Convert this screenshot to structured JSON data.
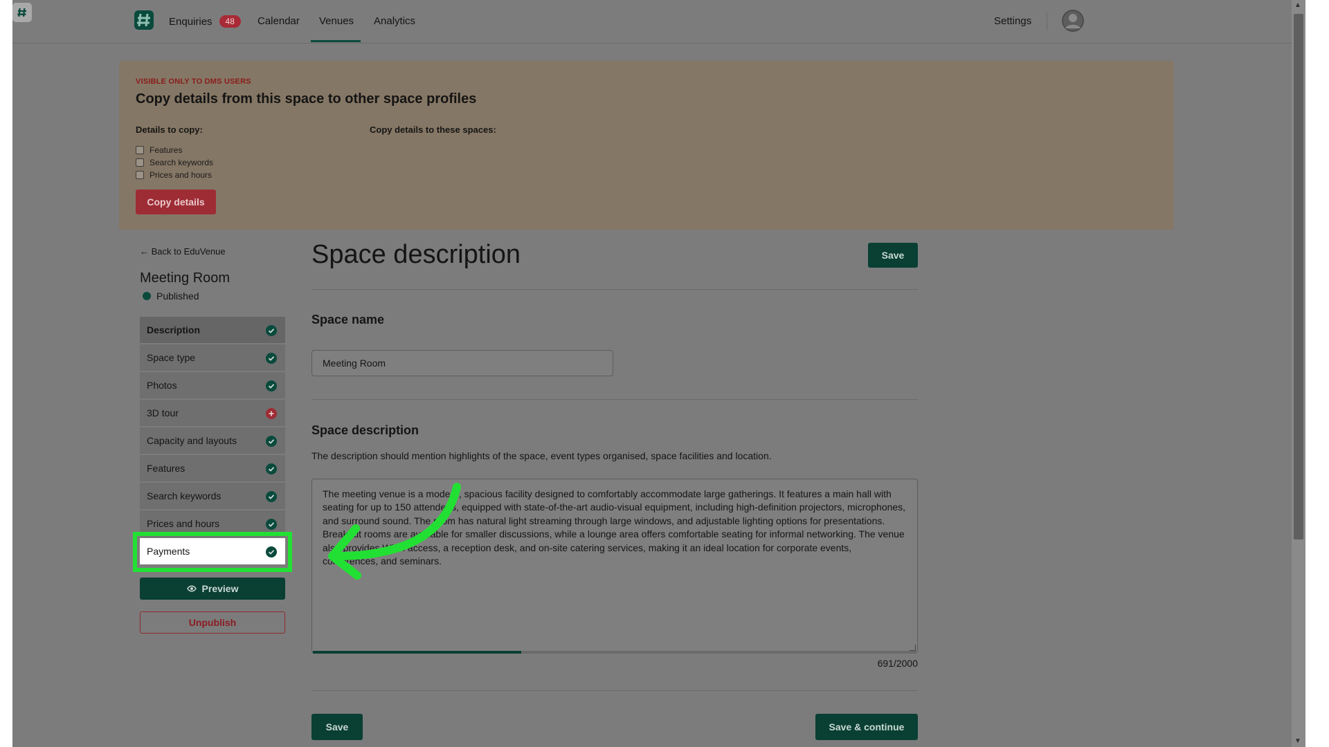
{
  "nav": {
    "items": [
      {
        "label": "Enquiries",
        "badge": "48"
      },
      {
        "label": "Calendar"
      },
      {
        "label": "Venues",
        "active": true
      },
      {
        "label": "Analytics"
      }
    ],
    "settings": "Settings"
  },
  "copy_panel": {
    "kicker": "VISIBLE ONLY TO DMS USERS",
    "title": "Copy details from this space to other space profiles",
    "details_label": "Details to copy:",
    "targets_label": "Copy details to these spaces:",
    "options": [
      "Features",
      "Search keywords",
      "Prices and hours"
    ],
    "button": "Copy details"
  },
  "sidebar": {
    "back_link": "Back to EduVenue",
    "room_title": "Meeting Room",
    "status": "Published",
    "items": [
      {
        "label": "Description",
        "status": "complete"
      },
      {
        "label": "Space type",
        "status": "complete"
      },
      {
        "label": "Photos",
        "status": "complete"
      },
      {
        "label": "3D tour",
        "status": "incomplete"
      },
      {
        "label": "Capacity and layouts",
        "status": "complete"
      },
      {
        "label": "Features",
        "status": "complete"
      },
      {
        "label": "Search keywords",
        "status": "complete"
      },
      {
        "label": "Prices and hours",
        "status": "complete"
      },
      {
        "label": "Payments",
        "status": "complete"
      }
    ],
    "preview": "Preview",
    "unpublish": "Unpublish"
  },
  "main": {
    "title": "Space description",
    "save_top": "Save",
    "space_name_heading": "Space name",
    "space_name_value": "Meeting Room",
    "description_heading": "Space description",
    "description_help": "The description should mention highlights of the space, event types organised, space facilities and location.",
    "description_text": "The meeting venue is a modern, spacious facility designed to comfortably accommodate large gatherings. It features a main hall with seating for up to 150 attendees, equipped with state-of-the-art audio-visual equipment, including high-definition projectors, microphones, and surround sound. The room has natural light streaming through large windows, and adjustable lighting options for presentations. Breakout rooms are available for smaller discussions, while a lounge area offers comfortable seating for informal networking. The venue also provides Wi-Fi access, a reception desk, and on-site catering services, making it an ideal location for corporate events, conferences, and seminars.",
    "char_progress": 0.3455,
    "char_count": "691/2000",
    "save_bottom": "Save",
    "save_continue": "Save & continue"
  },
  "colors": {
    "accent_green": "#0a3f33",
    "danger_red": "#9e2c35",
    "highlight_green": "#22e033"
  },
  "icons": {
    "brand": "hashtag-logo-icon",
    "back": "arrow-left-icon",
    "complete": "check-circle-icon",
    "incomplete": "plus-circle-icon",
    "preview": "eye-icon",
    "avatar": "user-avatar-icon"
  }
}
